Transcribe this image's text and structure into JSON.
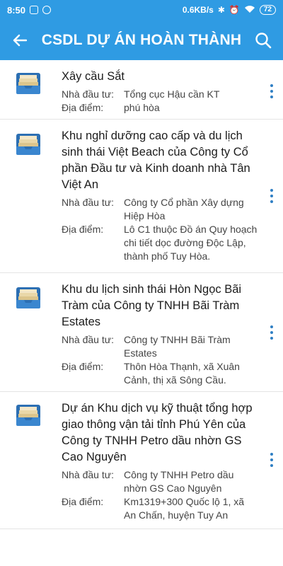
{
  "status_bar": {
    "time": "8:50",
    "speed": "0.6KB/s",
    "battery": "72"
  },
  "app_bar": {
    "title": "CSDL DỰ ÁN HOÀN THÀNH"
  },
  "labels": {
    "investor": "Nhà đầu tư:",
    "location": "Địa điểm:"
  },
  "projects": [
    {
      "name": "Xây cầu Sắt",
      "investor": "Tổng cục Hậu cần KT",
      "location": "phú hòa"
    },
    {
      "name": "Khu nghỉ dưỡng cao cấp và du lịch sinh thái Việt Beach của Công ty Cổ phần Đầu tư và Kinh doanh nhà Tân Việt An",
      "investor": "Công ty Cổ phần Xây dựng Hiệp Hòa",
      "location": "Lô C1 thuộc Đồ án Quy hoạch chi tiết dọc đường Độc Lập, thành phố Tuy Hòa."
    },
    {
      "name": "Khu du lịch sinh thái Hòn Ngọc Bãi Tràm của Công ty TNHH Bãi Tràm Estates",
      "investor": "Công ty TNHH Bãi Tràm Estates",
      "location": "Thôn Hòa Thạnh, xã Xuân Cảnh, thị xã Sông Cầu."
    },
    {
      "name": "Dự án Khu dịch vụ kỹ thuật tổng hợp giao thông vận tải tỉnh Phú Yên của Công ty TNHH Petro dầu nhờn GS Cao Nguyên",
      "investor": "Công ty TNHH Petro dầu nhờn GS Cao Nguyên",
      "location": "Km1319+300 Quốc lộ 1, xã An Chấn, huyện Tuy An"
    }
  ],
  "colors": {
    "primary": "#2f9be3",
    "divider": "#e4e4e4",
    "more_dots": "#2f7fc4"
  }
}
